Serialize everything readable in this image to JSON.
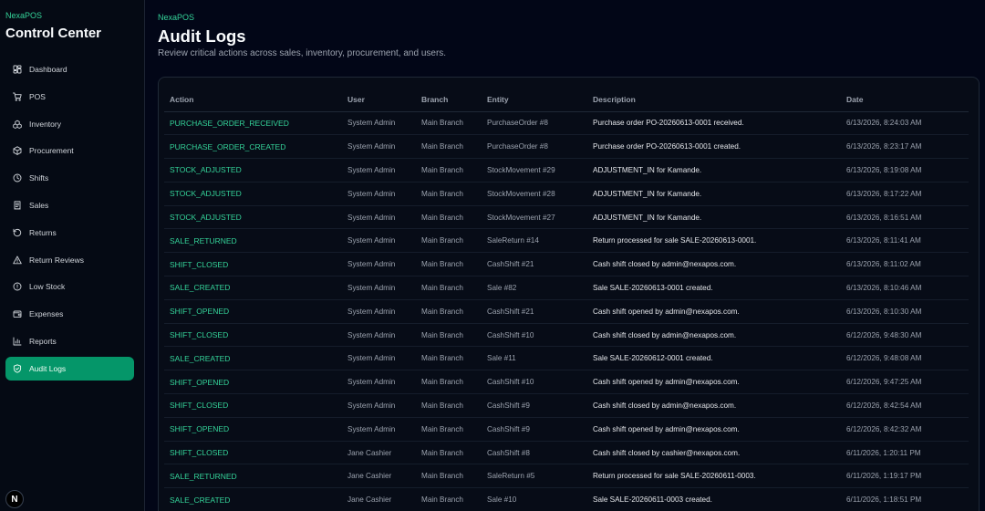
{
  "sidebar": {
    "brand": "NexaPOS",
    "title": "Control Center",
    "items": [
      {
        "label": "Dashboard",
        "icon": "dashboard-icon"
      },
      {
        "label": "POS",
        "icon": "cart-icon"
      },
      {
        "label": "Inventory",
        "icon": "boxes-icon"
      },
      {
        "label": "Procurement",
        "icon": "package-icon"
      },
      {
        "label": "Shifts",
        "icon": "clock-icon"
      },
      {
        "label": "Sales",
        "icon": "receipt-icon"
      },
      {
        "label": "Returns",
        "icon": "rotate-icon"
      },
      {
        "label": "Return Reviews",
        "icon": "warning-icon"
      },
      {
        "label": "Low Stock",
        "icon": "alert-circle-icon"
      },
      {
        "label": "Expenses",
        "icon": "wallet-icon"
      },
      {
        "label": "Reports",
        "icon": "bar-chart-icon"
      },
      {
        "label": "Audit Logs",
        "icon": "shield-icon",
        "active": true
      }
    ],
    "badge": "N"
  },
  "header": {
    "breadcrumb": "NexaPOS",
    "title": "Audit Logs",
    "subtitle": "Review critical actions across sales, inventory, procurement, and users."
  },
  "table": {
    "columns": [
      "Action",
      "User",
      "Branch",
      "Entity",
      "Description",
      "Date"
    ],
    "rows": [
      [
        "PURCHASE_ORDER_RECEIVED",
        "System Admin",
        "Main Branch",
        "PurchaseOrder #8",
        "Purchase order PO-20260613-0001 received.",
        "6/13/2026, 8:24:03 AM"
      ],
      [
        "PURCHASE_ORDER_CREATED",
        "System Admin",
        "Main Branch",
        "PurchaseOrder #8",
        "Purchase order PO-20260613-0001 created.",
        "6/13/2026, 8:23:17 AM"
      ],
      [
        "STOCK_ADJUSTED",
        "System Admin",
        "Main Branch",
        "StockMovement #29",
        "ADJUSTMENT_IN for Kamande.",
        "6/13/2026, 8:19:08 AM"
      ],
      [
        "STOCK_ADJUSTED",
        "System Admin",
        "Main Branch",
        "StockMovement #28",
        "ADJUSTMENT_IN for Kamande.",
        "6/13/2026, 8:17:22 AM"
      ],
      [
        "STOCK_ADJUSTED",
        "System Admin",
        "Main Branch",
        "StockMovement #27",
        "ADJUSTMENT_IN for Kamande.",
        "6/13/2026, 8:16:51 AM"
      ],
      [
        "SALE_RETURNED",
        "System Admin",
        "Main Branch",
        "SaleReturn #14",
        "Return processed for sale SALE-20260613-0001.",
        "6/13/2026, 8:11:41 AM"
      ],
      [
        "SHIFT_CLOSED",
        "System Admin",
        "Main Branch",
        "CashShift #21",
        "Cash shift closed by admin@nexapos.com.",
        "6/13/2026, 8:11:02 AM"
      ],
      [
        "SALE_CREATED",
        "System Admin",
        "Main Branch",
        "Sale #82",
        "Sale SALE-20260613-0001 created.",
        "6/13/2026, 8:10:46 AM"
      ],
      [
        "SHIFT_OPENED",
        "System Admin",
        "Main Branch",
        "CashShift #21",
        "Cash shift opened by admin@nexapos.com.",
        "6/13/2026, 8:10:30 AM"
      ],
      [
        "SHIFT_CLOSED",
        "System Admin",
        "Main Branch",
        "CashShift #10",
        "Cash shift closed by admin@nexapos.com.",
        "6/12/2026, 9:48:30 AM"
      ],
      [
        "SALE_CREATED",
        "System Admin",
        "Main Branch",
        "Sale #11",
        "Sale SALE-20260612-0001 created.",
        "6/12/2026, 9:48:08 AM"
      ],
      [
        "SHIFT_OPENED",
        "System Admin",
        "Main Branch",
        "CashShift #10",
        "Cash shift opened by admin@nexapos.com.",
        "6/12/2026, 9:47:25 AM"
      ],
      [
        "SHIFT_CLOSED",
        "System Admin",
        "Main Branch",
        "CashShift #9",
        "Cash shift closed by admin@nexapos.com.",
        "6/12/2026, 8:42:54 AM"
      ],
      [
        "SHIFT_OPENED",
        "System Admin",
        "Main Branch",
        "CashShift #9",
        "Cash shift opened by admin@nexapos.com.",
        "6/12/2026, 8:42:32 AM"
      ],
      [
        "SHIFT_CLOSED",
        "Jane Cashier",
        "Main Branch",
        "CashShift #8",
        "Cash shift closed by cashier@nexapos.com.",
        "6/11/2026, 1:20:11 PM"
      ],
      [
        "SALE_RETURNED",
        "Jane Cashier",
        "Main Branch",
        "SaleReturn #5",
        "Return processed for sale SALE-20260611-0003.",
        "6/11/2026, 1:19:17 PM"
      ],
      [
        "SALE_CREATED",
        "Jane Cashier",
        "Main Branch",
        "Sale #10",
        "Sale SALE-20260611-0003 created.",
        "6/11/2026, 1:18:51 PM"
      ]
    ]
  },
  "colors": {
    "accent": "#059669",
    "action_text": "#34d399",
    "background": "#020617"
  }
}
